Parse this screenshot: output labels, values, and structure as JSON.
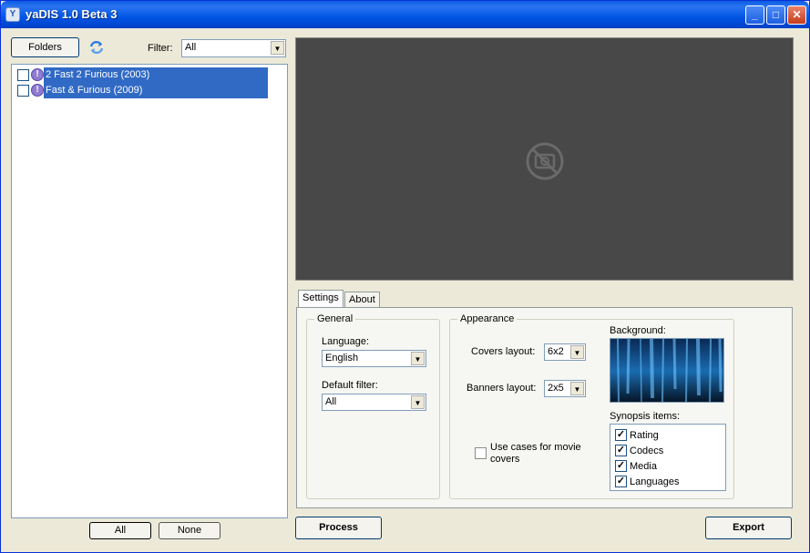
{
  "window": {
    "title": "yaDIS 1.0 Beta 3"
  },
  "left": {
    "folders_label": "Folders",
    "filter_label": "Filter:",
    "filter_value": "All",
    "items": [
      {
        "label": "2 Fast 2 Furious (2003)"
      },
      {
        "label": "Fast & Furious (2009)"
      }
    ],
    "all_label": "All",
    "none_label": "None"
  },
  "tabs": {
    "settings": "Settings",
    "about": "About"
  },
  "general": {
    "title": "General",
    "language_label": "Language:",
    "language_value": "English",
    "default_filter_label": "Default filter:",
    "default_filter_value": "All"
  },
  "appearance": {
    "title": "Appearance",
    "covers_label": "Covers layout:",
    "covers_value": "6x2",
    "banners_label": "Banners layout:",
    "banners_value": "2x5",
    "use_cases_label": "Use cases for movie covers",
    "background_label": "Background:",
    "synopsis_label": "Synopsis items:",
    "synopsis_items": [
      {
        "label": "Rating"
      },
      {
        "label": "Codecs"
      },
      {
        "label": "Media"
      },
      {
        "label": "Languages"
      }
    ]
  },
  "actions": {
    "process": "Process",
    "export": "Export"
  },
  "colors": {
    "preview_bg": "#484848",
    "selection": "#316ac5",
    "titlebar": "#0055e5"
  }
}
